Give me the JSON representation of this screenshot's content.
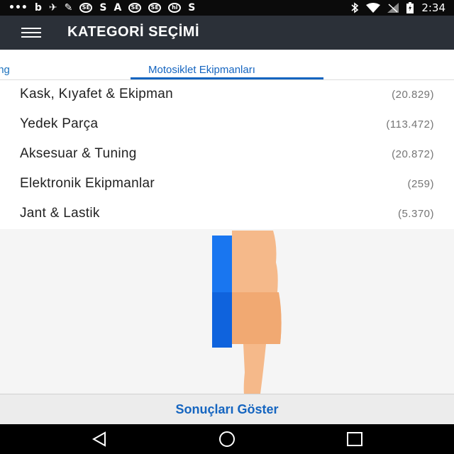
{
  "status_bar": {
    "time": "2:34",
    "left_icons": [
      {
        "name": "message-icon",
        "glyph": "•••"
      },
      {
        "name": "b-app-icon",
        "glyph": "b"
      },
      {
        "name": "motorcycle-icon",
        "glyph": "✈"
      },
      {
        "name": "wrench-icon",
        "glyph": "✎"
      },
      {
        "name": "sahibinden-icon",
        "glyph": "SE"
      },
      {
        "name": "s-app-icon",
        "glyph": "S"
      },
      {
        "name": "a-app-icon",
        "glyph": "A"
      },
      {
        "name": "sahibinden-icon-2",
        "glyph": "SE"
      },
      {
        "name": "sahibinden-icon-3",
        "glyph": "SE"
      },
      {
        "name": "hi-app-icon",
        "glyph": "hi"
      },
      {
        "name": "s-app-icon-2",
        "glyph": "S"
      }
    ]
  },
  "app_bar": {
    "title": "KATEGORİ SEÇİMİ"
  },
  "tabs": [
    {
      "label": "Aksesuar & Tuning",
      "active": false
    },
    {
      "label": "Motosiklet Ekipmanları",
      "active": true
    }
  ],
  "categories": [
    {
      "label": "Kask, Kıyafet & Ekipman",
      "count": "(20.829)"
    },
    {
      "label": "Yedek Parça",
      "count": "(113.472)"
    },
    {
      "label": "Aksesuar & Tuning",
      "count": "(20.872)"
    },
    {
      "label": "Elektronik Ekipmanlar",
      "count": "(259)"
    },
    {
      "label": "Jant & Lastik",
      "count": "(5.370)"
    }
  ],
  "bottom": {
    "show_results_label": "Sonuçları Göster"
  },
  "colors": {
    "app_bar": "#2b3038",
    "accent": "#1565c0",
    "status_bar": "#0b0b0b"
  }
}
